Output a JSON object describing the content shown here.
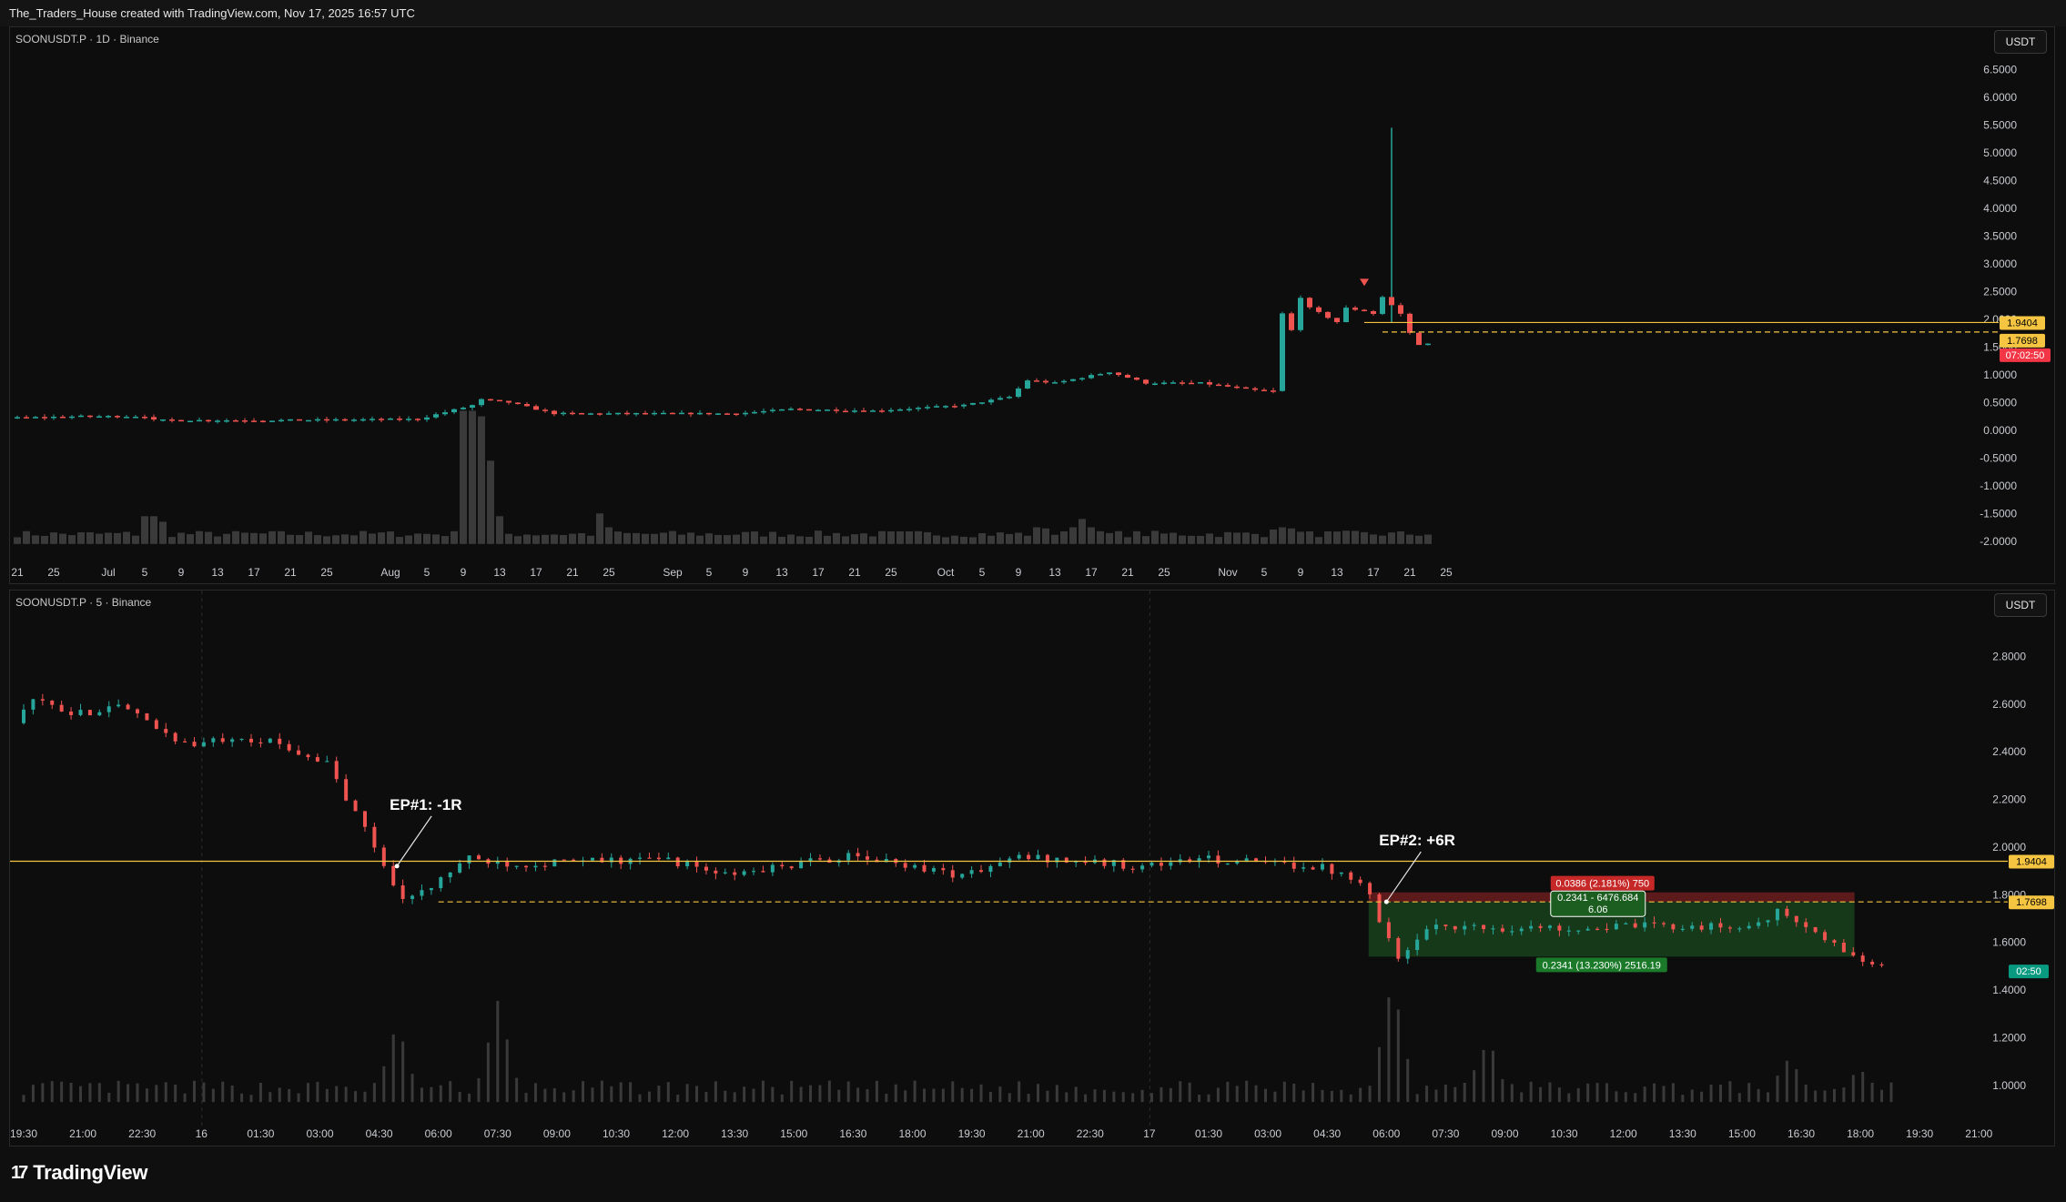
{
  "header": {
    "title": "The_Traders_House created with TradingView.com, Nov 17, 2025 16:57 UTC"
  },
  "footer": {
    "brand": "TradingView",
    "logo_icon": "tradingview-logo-icon"
  },
  "colors": {
    "up": "#26a69a",
    "down": "#ef5350",
    "level": "#f5c542",
    "profit_zone": "#1b4d1f",
    "loss_zone": "#6b1d1d",
    "countdown": "#f23645",
    "countdown2": "#089981"
  },
  "chart_data": [
    {
      "type": "candlestick",
      "symbol": "SOONUSDT.P · 1D · Binance",
      "currency_button": "USDT",
      "ylim": [
        -2.25,
        6.9
      ],
      "yticks": [
        {
          "v": 6.5,
          "label": "6.5000"
        },
        {
          "v": 6.0,
          "label": "6.0000"
        },
        {
          "v": 5.5,
          "label": "5.5000"
        },
        {
          "v": 5.0,
          "label": "5.0000"
        },
        {
          "v": 4.5,
          "label": "4.5000"
        },
        {
          "v": 4.0,
          "label": "4.0000"
        },
        {
          "v": 3.5,
          "label": "3.5000"
        },
        {
          "v": 3.0,
          "label": "3.0000"
        },
        {
          "v": 2.5,
          "label": "2.5000"
        },
        {
          "v": 2.0,
          "label": "2.0000"
        },
        {
          "v": 1.5,
          "label": "1.5000"
        },
        {
          "v": 1.0,
          "label": "1.0000"
        },
        {
          "v": 0.5,
          "label": "0.5000"
        },
        {
          "v": 0.0,
          "label": "0.0000"
        },
        {
          "v": -0.5,
          "label": "-0.5000"
        },
        {
          "v": -1.0,
          "label": "-1.0000"
        },
        {
          "v": -1.5,
          "label": "-1.5000"
        },
        {
          "v": -2.0,
          "label": "-2.0000"
        }
      ],
      "xticks": [
        "21",
        "25",
        "Jul",
        "5",
        "9",
        "13",
        "17",
        "21",
        "25",
        "Aug",
        "5",
        "9",
        "13",
        "17",
        "21",
        "25",
        "Sep",
        "5",
        "9",
        "13",
        "17",
        "21",
        "25",
        "Oct",
        "5",
        "9",
        "13",
        "17",
        "21",
        "25",
        "Nov",
        "5",
        "9",
        "13",
        "17",
        "21",
        "25"
      ],
      "xtick_index": [
        0,
        4,
        10,
        14,
        18,
        22,
        26,
        30,
        34,
        41,
        45,
        49,
        53,
        57,
        61,
        65,
        72,
        76,
        80,
        84,
        88,
        92,
        96,
        102,
        106,
        110,
        114,
        118,
        122,
        126,
        133,
        137,
        141,
        145,
        149,
        153,
        157
      ],
      "x_count": 165,
      "anchors": [
        [
          0,
          0.22
        ],
        [
          8,
          0.25
        ],
        [
          15,
          0.25
        ],
        [
          16,
          0.18
        ],
        [
          30,
          0.18
        ],
        [
          45,
          0.2
        ],
        [
          51,
          0.45
        ],
        [
          52,
          0.55
        ],
        [
          55,
          0.5
        ],
        [
          60,
          0.3
        ],
        [
          75,
          0.3
        ],
        [
          80,
          0.3
        ],
        [
          86,
          0.38
        ],
        [
          95,
          0.35
        ],
        [
          105,
          0.45
        ],
        [
          110,
          0.6
        ],
        [
          112,
          0.9
        ],
        [
          115,
          0.85
        ],
        [
          118,
          0.95
        ],
        [
          121,
          1.05
        ],
        [
          125,
          0.85
        ],
        [
          131,
          0.85
        ],
        [
          137,
          0.72
        ],
        [
          139,
          0.7
        ],
        [
          140,
          2.1
        ],
        [
          141,
          1.8
        ],
        [
          142,
          2.4
        ],
        [
          143,
          2.2
        ],
        [
          146,
          1.95
        ],
        [
          147,
          2.2
        ],
        [
          149,
          2.15
        ],
        [
          150,
          2.1
        ],
        [
          151,
          2.4
        ],
        [
          153,
          2.1
        ],
        [
          154,
          1.75
        ],
        [
          155,
          1.55
        ]
      ],
      "volume_bars": [
        [
          49,
          2.4
        ],
        [
          50,
          2.4
        ],
        [
          51,
          2.3
        ],
        [
          52,
          1.5
        ],
        [
          53,
          0.5
        ],
        [
          14,
          0.5
        ],
        [
          15,
          0.5
        ],
        [
          16,
          0.4
        ],
        [
          64,
          0.55
        ],
        [
          65,
          0.3
        ],
        [
          112,
          0.3
        ],
        [
          113,
          0.28
        ],
        [
          116,
          0.3
        ],
        [
          117,
          0.45
        ],
        [
          118,
          0.3
        ],
        [
          138,
          0.26
        ],
        [
          139,
          0.3
        ],
        [
          140,
          0.28
        ],
        [
          141,
          0.22
        ]
      ],
      "spike": {
        "i": 151,
        "high": 5.45,
        "low": 1.95
      },
      "signal_marker": {
        "i": 148,
        "v": 2.5
      },
      "levels": [
        {
          "v": 1.9404,
          "label": "1.9404",
          "style": "solid",
          "from_i": 148
        },
        {
          "v": 1.7698,
          "label": "1.7698",
          "style": "dashed",
          "from_i": 150
        }
      ],
      "countdown": "07:02:50"
    },
    {
      "type": "candlestick",
      "symbol": "SOONUSDT.P · 5 · Binance",
      "currency_button": "USDT",
      "ylim": [
        0.9,
        3.0
      ],
      "yticks": [
        {
          "v": 2.8,
          "label": "2.8000"
        },
        {
          "v": 2.6,
          "label": "2.6000"
        },
        {
          "v": 2.4,
          "label": "2.4000"
        },
        {
          "v": 2.2,
          "label": "2.2000"
        },
        {
          "v": 2.0,
          "label": "2.0000"
        },
        {
          "v": 1.8,
          "label": "1.8000"
        },
        {
          "v": 1.6,
          "label": "1.6000"
        },
        {
          "v": 1.4,
          "label": "1.4000"
        },
        {
          "v": 1.2,
          "label": "1.2000"
        },
        {
          "v": 1.0,
          "label": "1.0000"
        }
      ],
      "xticks": [
        "19:30",
        "21:00",
        "22:30",
        "16",
        "01:30",
        "03:00",
        "04:30",
        "06:00",
        "07:30",
        "09:00",
        "10:30",
        "12:00",
        "13:30",
        "15:00",
        "16:30",
        "18:00",
        "19:30",
        "21:00",
        "22:30",
        "17",
        "01:30",
        "03:00",
        "04:30",
        "06:00",
        "07:30",
        "09:00",
        "10:30",
        "12:00",
        "13:30",
        "15:00",
        "16:30",
        "18:00",
        "19:30",
        "21:00"
      ],
      "x_count": 34,
      "anchors": [
        [
          0,
          2.52
        ],
        [
          0.3,
          2.62
        ],
        [
          1,
          2.55
        ],
        [
          1.7,
          2.6
        ],
        [
          2.4,
          2.5
        ],
        [
          3,
          2.42
        ],
        [
          3.7,
          2.47
        ],
        [
          4.5,
          2.43
        ],
        [
          5.3,
          2.35
        ],
        [
          5.6,
          2.2
        ],
        [
          6.0,
          2.05
        ],
        [
          6.3,
          1.88
        ],
        [
          6.6,
          1.78
        ],
        [
          7.0,
          1.82
        ],
        [
          7.6,
          1.95
        ],
        [
          8.5,
          1.93
        ],
        [
          11,
          1.95
        ],
        [
          12,
          1.88
        ],
        [
          14,
          1.96
        ],
        [
          15,
          1.93
        ],
        [
          16,
          1.88
        ],
        [
          17,
          1.96
        ],
        [
          19,
          1.92
        ],
        [
          20,
          1.95
        ],
        [
          22,
          1.92
        ],
        [
          22.8,
          1.86
        ],
        [
          23.1,
          1.65
        ],
        [
          23.4,
          1.53
        ],
        [
          24,
          1.68
        ],
        [
          24.7,
          1.66
        ],
        [
          26,
          1.66
        ],
        [
          28,
          1.67
        ],
        [
          29.2,
          1.66
        ],
        [
          29.8,
          1.73
        ],
        [
          30.5,
          1.62
        ],
        [
          31.2,
          1.52
        ],
        [
          31.5,
          1.5
        ]
      ],
      "vol_spikes": [
        [
          6.3,
          0.32
        ],
        [
          8.0,
          0.4
        ],
        [
          23.1,
          0.5
        ],
        [
          24.7,
          0.25
        ],
        [
          29.8,
          0.18
        ],
        [
          31.0,
          0.14
        ]
      ],
      "levels": [
        {
          "v": 1.9404,
          "label": "1.9404",
          "style": "solid"
        },
        {
          "v": 1.7698,
          "label": "1.7698",
          "style": "dashed",
          "from_x": 7.0
        }
      ],
      "countdown": "02:50",
      "annotations": [
        {
          "text": "EP#1: -1R",
          "at_x": 6.3,
          "at_v": 1.92
        },
        {
          "text": "EP#2: +6R",
          "at_x": 23.0,
          "at_v": 1.77
        }
      ],
      "position": {
        "x0": 22.7,
        "x1": 30.9,
        "entry": 1.7698,
        "stop": 1.81,
        "target": 1.54,
        "stop_label": "0.0386 (2.181%) 750",
        "target_label": "0.2341 (13.230%) 2516.19",
        "center_label_1": "0.2341 - 6476.684",
        "center_label_2": "6.06"
      }
    }
  ]
}
